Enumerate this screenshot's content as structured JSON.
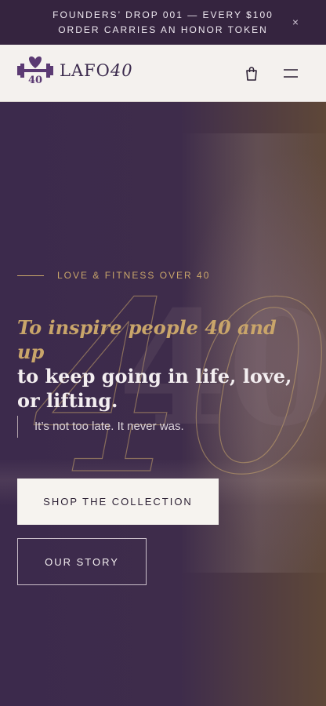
{
  "announcement": {
    "text": "FOUNDERS’ DROP 001 — EVERY $100 ORDER CARRIES AN HONOR TOKEN",
    "close_label": "×"
  },
  "header": {
    "logo": {
      "word": "LAFO",
      "number": "40",
      "badge_number": "40"
    },
    "icons": [
      "shopping-bag-icon",
      "hamburger-menu-icon"
    ]
  },
  "hero": {
    "eyebrow": "LOVE & FITNESS OVER 40",
    "headline_accent": "To inspire people 40 and up",
    "headline_rest": "to keep going in life, love, or lifting.",
    "quote": "It’s not too late. It never was.",
    "primary_button": "SHOP THE COLLECTION",
    "secondary_button": "OUR STORY",
    "decorative_number": "40"
  },
  "colors": {
    "brand_purple": "#3b2a4d",
    "gold_accent": "#c9a56a",
    "cream": "#f4f1ee"
  }
}
